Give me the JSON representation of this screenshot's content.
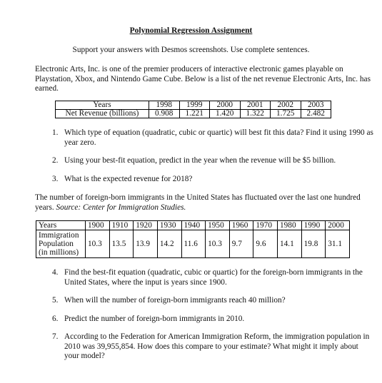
{
  "title": "Polynomial Regression Assignment",
  "subtitle": "Support your answers with Desmos screenshots.  Use complete sentences.",
  "intro1": "Electronic Arts, Inc. is one of the premier producers of interactive electronic games playable on Playstation, Xbox, and Nintendo Game Cube.  Below is a list of the net revenue Electronic Arts, Inc. has earned.",
  "table1": {
    "row_headers": [
      "Years",
      "Net Revenue (billions)"
    ],
    "years": [
      "1998",
      "1999",
      "2000",
      "2001",
      "2002",
      "2003"
    ],
    "values": [
      "0.908",
      "1.221",
      "1.420",
      "1.322",
      "1.725",
      "2.482"
    ]
  },
  "questions1": [
    {
      "num": "1.",
      "text": "Which type of equation (quadratic, cubic or quartic) will best fit this data?  Find it using 1990 as year zero."
    },
    {
      "num": "2.",
      "text": "Using your best-fit equation, predict in the year when the revenue will be $5 billion."
    },
    {
      "num": "3.",
      "text": "What is the expected revenue for 2018?"
    }
  ],
  "intro2": {
    "text": "The number of foreign-born immigrants in the United States has fluctuated over the last one hundred years.  ",
    "source": "Source: Center for Immigration Studies."
  },
  "table2": {
    "row_headers": [
      "Years",
      "Immigration Population (in millions)"
    ],
    "years": [
      "1900",
      "1910",
      "1920",
      "1930",
      "1940",
      "1950",
      "1960",
      "1970",
      "1980",
      "1990",
      "2000"
    ],
    "values": [
      "10.3",
      "13.5",
      "13.9",
      "14.2",
      "11.6",
      "10.3",
      "9.7",
      "9.6",
      "14.1",
      "19.8",
      "31.1"
    ]
  },
  "questions2": [
    {
      "num": "4.",
      "text": "Find the best-fit equation (quadratic, cubic or quartic) for the foreign-born immigrants in the United States, where the input is years since 1900."
    },
    {
      "num": "5.",
      "text": "When will the number of foreign-born immigrants reach 40 million?"
    },
    {
      "num": "6.",
      "text": "Predict the number of foreign-born immigrants in 2010."
    },
    {
      "num": "7.",
      "text": "According to the Federation for American Immigration Reform, the immigration population in 2010 was 39,955,854.  How does this compare to your estimate?  What might it imply about your model?"
    }
  ]
}
